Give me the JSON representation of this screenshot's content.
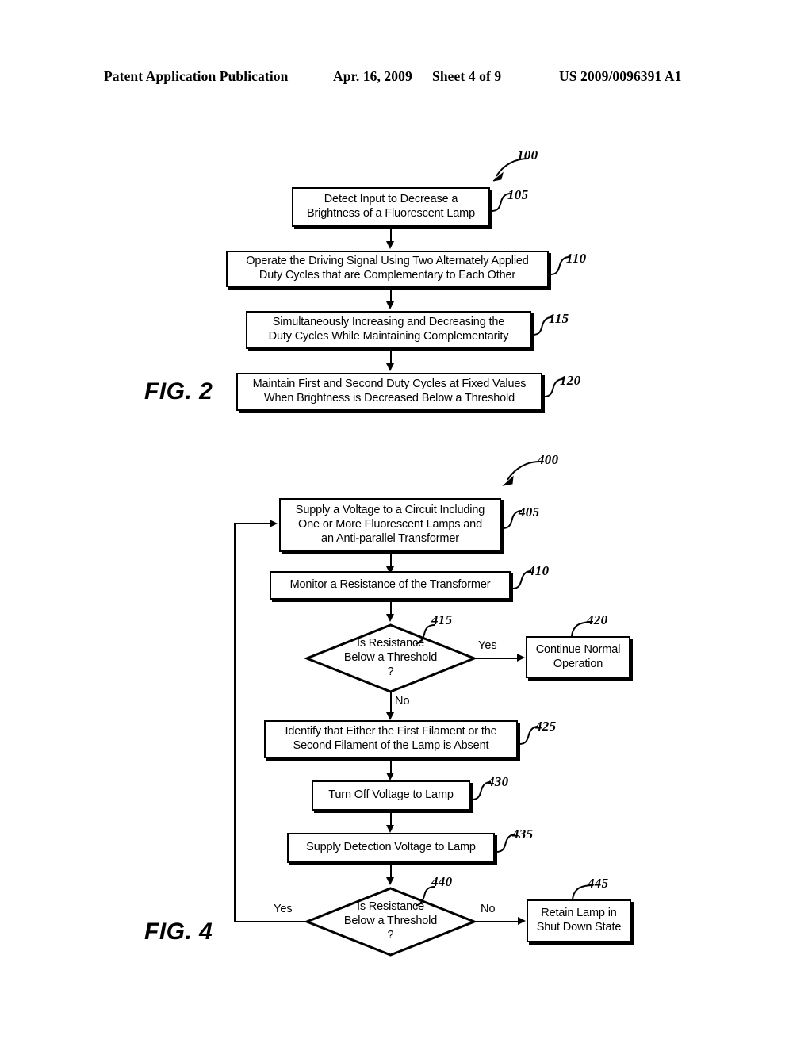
{
  "header": {
    "publication": "Patent Application Publication",
    "date": "Apr. 16, 2009",
    "sheet": "Sheet 4 of 9",
    "patent_number": "US 2009/0096391 A1"
  },
  "figures": [
    {
      "caption": "FIG. 2",
      "diagram_ref": "100",
      "nodes": [
        {
          "ref": "105",
          "type": "process",
          "text": "Detect Input to Decrease a Brightness of a Fluorescent Lamp"
        },
        {
          "ref": "110",
          "type": "process",
          "text": "Operate the Driving Signal Using Two Alternately Applied Duty Cycles that are Complementary to Each Other"
        },
        {
          "ref": "115",
          "type": "process",
          "text": "Simultaneously Increasing and Decreasing the Duty Cycles While Maintaining Complementarity"
        },
        {
          "ref": "120",
          "type": "process",
          "text": "Maintain First and Second Duty Cycles at Fixed Values When Brightness is Decreased Below a Threshold"
        }
      ]
    },
    {
      "caption": "FIG. 4",
      "diagram_ref": "400",
      "nodes": [
        {
          "ref": "405",
          "type": "process",
          "text": "Supply a Voltage to a Circuit Including One or More Fluorescent Lamps and an Anti-parallel Transformer"
        },
        {
          "ref": "410",
          "type": "process",
          "text": "Monitor a Resistance of the Transformer"
        },
        {
          "ref": "415",
          "type": "decision",
          "text": "Is Resistance Below a Threshold ?"
        },
        {
          "ref": "420",
          "type": "process",
          "text": "Continue Normal Operation"
        },
        {
          "ref": "425",
          "type": "process",
          "text": "Identify that Either the First Filament or the Second Filament of the Lamp is Absent"
        },
        {
          "ref": "430",
          "type": "process",
          "text": "Turn Off Voltage to Lamp"
        },
        {
          "ref": "435",
          "type": "process",
          "text": "Supply Detection Voltage to Lamp"
        },
        {
          "ref": "440",
          "type": "decision",
          "text": "Is Resistance Below a Threshold ?"
        },
        {
          "ref": "445",
          "type": "process",
          "text": "Retain Lamp in Shut Down State"
        }
      ],
      "branch_labels": {
        "d415_yes": "Yes",
        "d415_no": "No",
        "d440_yes": "Yes",
        "d440_no": "No"
      }
    }
  ],
  "fig2": {
    "caption": "FIG. 2",
    "ref_diagram": "100",
    "box105": {
      "line1": "Detect Input to Decrease a",
      "line2": "Brightness of a Fluorescent Lamp",
      "ref": "105"
    },
    "box110": {
      "line1": "Operate the Driving Signal Using Two Alternately Applied",
      "line2": "Duty Cycles that are Complementary to Each Other",
      "ref": "110"
    },
    "box115": {
      "line1": "Simultaneously Increasing and Decreasing the",
      "line2": "Duty Cycles While Maintaining Complementarity",
      "ref": "115"
    },
    "box120": {
      "line1": "Maintain First and Second Duty Cycles at Fixed Values",
      "line2": "When Brightness is Decreased Below a Threshold",
      "ref": "120"
    }
  },
  "fig4": {
    "caption": "FIG. 4",
    "ref_diagram": "400",
    "box405": {
      "line1": "Supply a Voltage to a Circuit Including",
      "line2": "One or More Fluorescent Lamps and",
      "line3": "an Anti-parallel Transformer",
      "ref": "405"
    },
    "box410": {
      "line1": "Monitor a Resistance of the Transformer",
      "ref": "410"
    },
    "diamond415": {
      "line1": "Is Resistance",
      "line2": "Below a Threshold",
      "line3": "?",
      "ref": "415"
    },
    "box420": {
      "line1": "Continue Normal",
      "line2": "Operation",
      "ref": "420"
    },
    "box425": {
      "line1": "Identify that Either the First Filament or the",
      "line2": "Second Filament of the Lamp is Absent",
      "ref": "425"
    },
    "box430": {
      "line1": "Turn Off Voltage to Lamp",
      "ref": "430"
    },
    "box435": {
      "line1": "Supply Detection Voltage to Lamp",
      "ref": "435"
    },
    "diamond440": {
      "line1": "Is Resistance",
      "line2": "Below a Threshold",
      "line3": "?",
      "ref": "440"
    },
    "box445": {
      "line1": "Retain Lamp in",
      "line2": "Shut Down State",
      "ref": "445"
    },
    "yes415": "Yes",
    "no415": "No",
    "yes440": "Yes",
    "no440": "No"
  },
  "colors": {
    "ink": "#000000",
    "paper": "#ffffff"
  }
}
